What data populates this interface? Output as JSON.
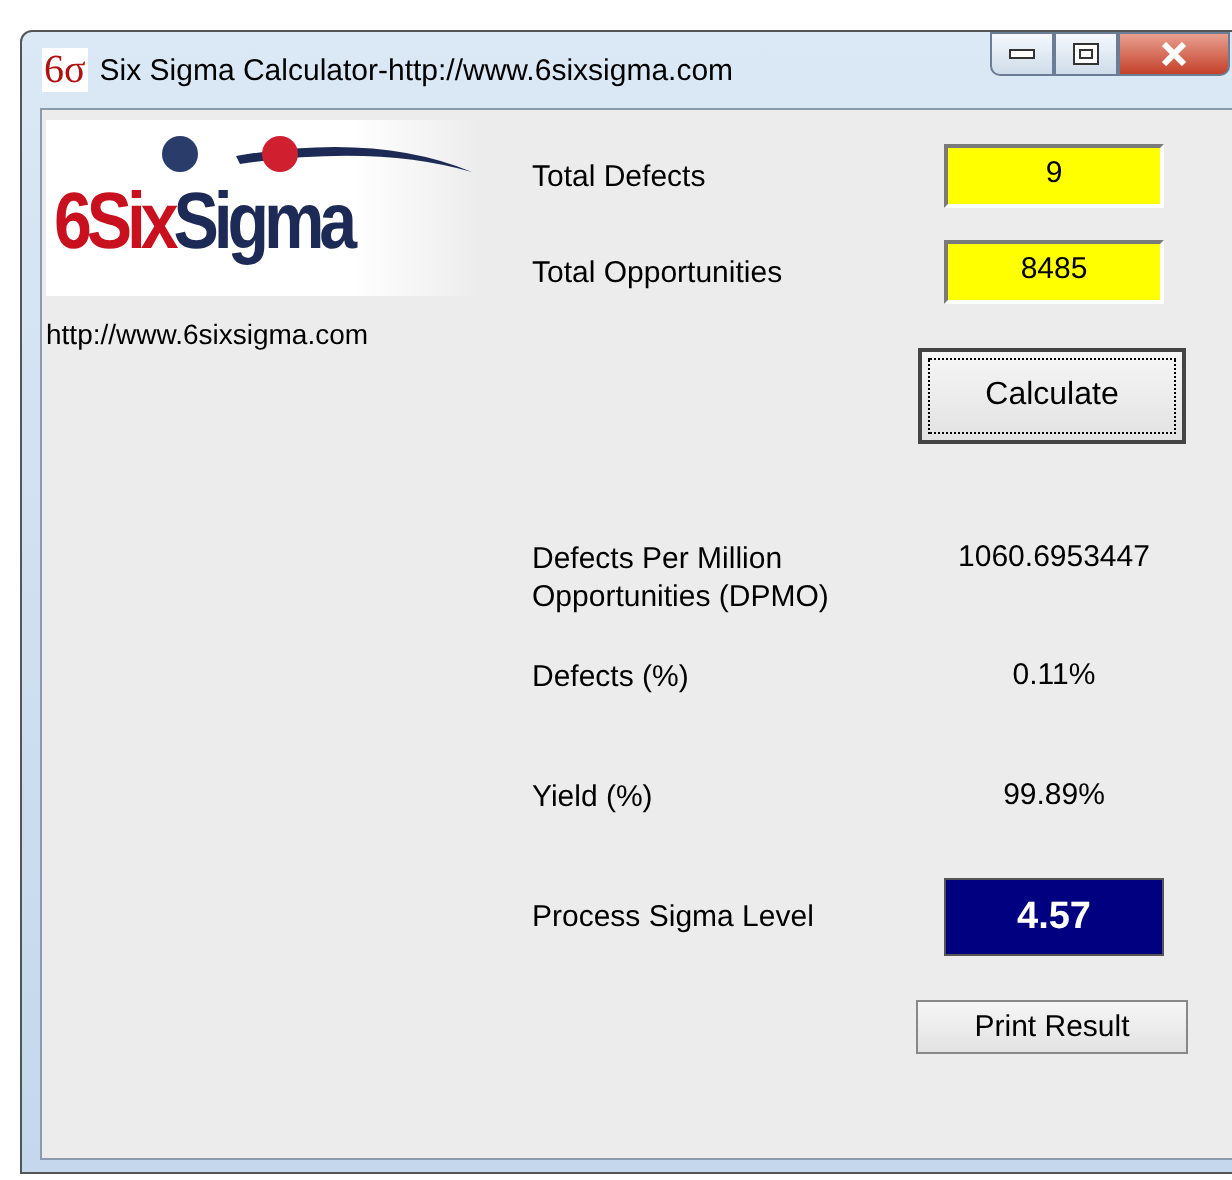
{
  "window": {
    "icon_text": "6σ",
    "title": "Six Sigma Calculator-http://www.6sixsigma.com"
  },
  "logo": {
    "red_part": "6Six",
    "blue_part": "Sigma"
  },
  "url": "http://www.6sixsigma.com",
  "inputs": [
    {
      "label": "Total Defects",
      "value": "9"
    },
    {
      "label": "Total Opportunities",
      "value": "8485"
    }
  ],
  "calculate_button": "Calculate",
  "results": [
    {
      "label": "Defects Per Million Opportunities (DPMO)",
      "value": "1060.6953447",
      "kind": "plain"
    },
    {
      "label": "Defects (%)",
      "value": "0.11%",
      "kind": "plain"
    },
    {
      "label": "Yield (%)",
      "value": "99.89%",
      "kind": "plain"
    },
    {
      "label": "Process Sigma Level",
      "value": "4.57",
      "kind": "highlight"
    }
  ],
  "print_button": "Print Result"
}
